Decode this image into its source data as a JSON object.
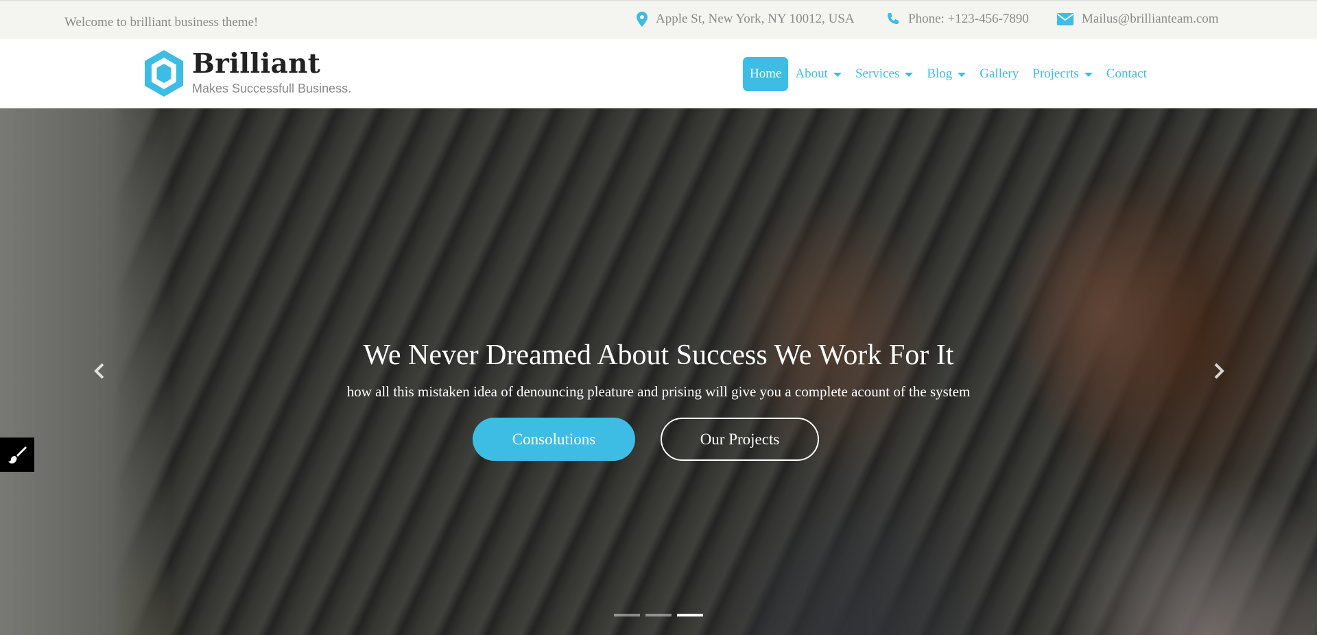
{
  "topbar": {
    "welcome": "Welcome to brilliant business theme!",
    "address": "Apple St, New York, NY 10012, USA",
    "phone": "Phone: +123-456-7890",
    "email": "Mailus@brillianteam.com",
    "icons": [
      "map-pin-icon",
      "phone-icon",
      "envelope-icon"
    ]
  },
  "brand": {
    "name": "Brilliant",
    "tagline": "Makes Successfull Business."
  },
  "nav": {
    "items": [
      {
        "label": "Home",
        "active": true,
        "dropdown": false
      },
      {
        "label": "About",
        "active": false,
        "dropdown": true
      },
      {
        "label": "Services",
        "active": false,
        "dropdown": true
      },
      {
        "label": "Blog",
        "active": false,
        "dropdown": true
      },
      {
        "label": "Gallery",
        "active": false,
        "dropdown": false
      },
      {
        "label": "Projecrts",
        "active": false,
        "dropdown": true
      },
      {
        "label": "Contact",
        "active": false,
        "dropdown": false
      }
    ]
  },
  "hero": {
    "title": "We Never Dreamed About Success We Work For It",
    "subtitle": "how all this mistaken idea of denouncing pleature and prising will give you a complete acount of the system",
    "primary_button": "Consolutions",
    "secondary_button": "Our Projects",
    "slide_count": 3,
    "active_slide": 3
  },
  "colors": {
    "accent": "#3dbde3",
    "topbar_bg": "#f4f4f0",
    "muted_text": "#8a8a8a"
  }
}
